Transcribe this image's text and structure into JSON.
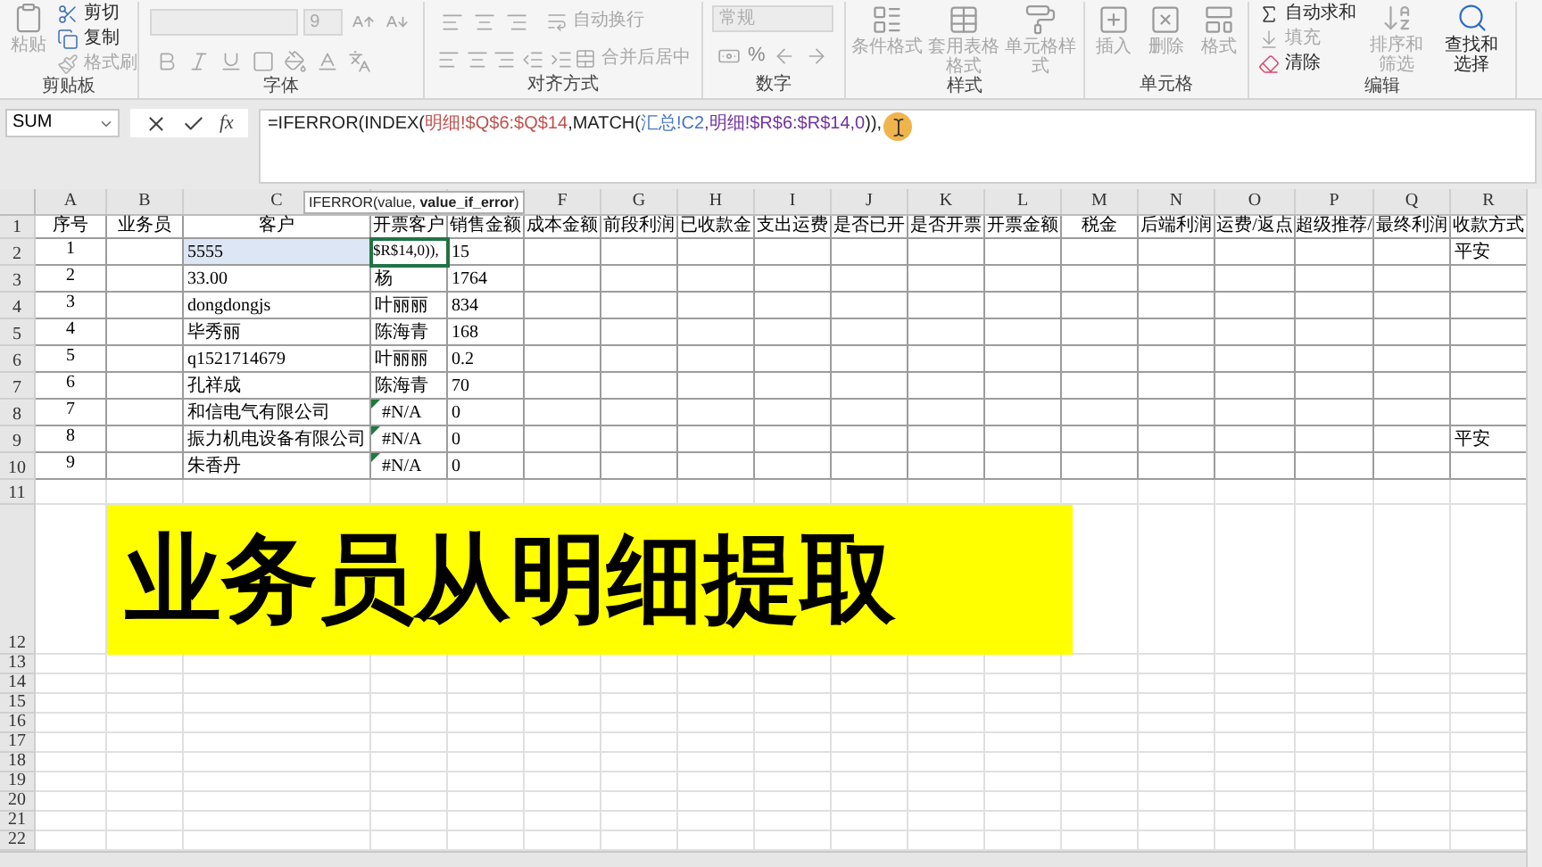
{
  "ribbon": {
    "groups": [
      {
        "kind": "clipboard",
        "label": "剪贴板",
        "buttons": [
          {
            "label": "粘贴",
            "disabled": true
          },
          {
            "label": "剪切",
            "disabled": false
          },
          {
            "label": "复制",
            "disabled": false
          },
          {
            "label": "格式刷",
            "disabled": true
          }
        ]
      },
      {
        "kind": "font",
        "label": "字体",
        "size": "9"
      },
      {
        "kind": "alignment",
        "label": "对齐方式",
        "buttons": [
          {
            "label": "自动换行",
            "disabled": true
          },
          {
            "label": "合并后居中",
            "disabled": true
          }
        ]
      },
      {
        "kind": "number",
        "label": "数字",
        "format": "常规",
        "percent": "%"
      },
      {
        "kind": "styles",
        "label": "样式",
        "buttons": [
          {
            "label": "条件格式",
            "disabled": true
          },
          {
            "label": "套用表格格式",
            "disabled": true
          },
          {
            "label": "单元格样式",
            "disabled": true
          }
        ]
      },
      {
        "kind": "cells",
        "label": "单元格",
        "buttons": [
          {
            "label": "插入",
            "disabled": true
          },
          {
            "label": "删除",
            "disabled": true
          },
          {
            "label": "格式",
            "disabled": true
          }
        ]
      },
      {
        "kind": "editing",
        "label": "编辑",
        "small": [
          {
            "label": "自动求和",
            "disabled": false
          },
          {
            "label": "填充",
            "disabled": true
          },
          {
            "label": "清除",
            "disabled": false
          }
        ],
        "large": [
          {
            "label": "排序和筛选",
            "disabled": true
          },
          {
            "label": "查找和选择",
            "disabled": false
          }
        ]
      }
    ]
  },
  "formula_bar": {
    "name_box": "SUM",
    "function_button": "fx",
    "segments": [
      {
        "text": "=IFERROR(INDEX(",
        "color": "#222222"
      },
      {
        "text": "明细!$Q$6:$Q$14",
        "color": "#c0504d"
      },
      {
        "text": ",MATCH(",
        "color": "#222222"
      },
      {
        "text": "汇总!C2",
        "color": "#4472c4"
      },
      {
        "text": ",明细!$R$6:$R$14,0",
        "color": "#7030a0"
      },
      {
        "text": ")),",
        "color": "#222222"
      }
    ]
  },
  "tooltip": "IFERROR(value, **value_if_error**)",
  "columns": [
    {
      "letter": "A"
    },
    {
      "letter": "B"
    },
    {
      "letter": "C"
    },
    {},
    {},
    {
      "letter": "F"
    },
    {
      "letter": "G"
    },
    {
      "letter": "H"
    },
    {
      "letter": "I"
    },
    {
      "letter": "J"
    },
    {
      "letter": "K"
    },
    {
      "letter": "L"
    },
    {
      "letter": "M"
    },
    {
      "letter": "N"
    },
    {
      "letter": "O"
    },
    {
      "letter": "P"
    },
    {
      "letter": "Q"
    },
    {
      "letter": "R"
    }
  ],
  "rows": [
    {
      "number": "1",
      "cells": [
        {
          "text": "序号"
        },
        {
          "text": "业务员"
        },
        {
          "text": "客户"
        },
        {
          "text": "开票客户"
        },
        {
          "text": "销售金额"
        },
        {
          "text": "成本金额"
        },
        {
          "text": "前段利润"
        },
        {
          "text": "已收款金"
        },
        {
          "text": "支出运费"
        },
        {
          "text": "是否已开"
        },
        {
          "text": "是否开票"
        },
        {
          "text": "开票金额"
        },
        {
          "text": "税金"
        },
        {
          "text": "后端利润"
        },
        {
          "text": "运费/返点"
        },
        {
          "text": "超级推荐/"
        },
        {
          "text": "最终利润"
        },
        {
          "text": "收款方式"
        }
      ]
    },
    {
      "number": "2",
      "cells": [
        {
          "text": "1"
        },
        null,
        {
          "text": "5555",
          "highlighted": true
        },
        {
          "text": "$R$14,0)),",
          "active": true
        },
        {
          "text": "15"
        },
        null,
        null,
        null,
        null,
        null,
        null,
        null,
        null,
        null,
        null,
        null,
        null,
        {
          "text": "平安"
        }
      ]
    },
    {
      "number": "3",
      "cells": [
        {
          "text": "2"
        },
        null,
        {
          "text": "33.00"
        },
        {
          "text": "杨"
        },
        {
          "text": "1764"
        }
      ]
    },
    {
      "number": "4",
      "cells": [
        {
          "text": "3"
        },
        null,
        {
          "text": "dongdongjs"
        },
        {
          "text": "叶丽丽"
        },
        {
          "text": "834"
        }
      ]
    },
    {
      "number": "5",
      "cells": [
        {
          "text": "4"
        },
        null,
        {
          "text": "毕秀丽"
        },
        {
          "text": "陈海青"
        },
        {
          "text": "168"
        }
      ]
    },
    {
      "number": "6",
      "cells": [
        {
          "text": "5"
        },
        null,
        {
          "text": "q1521714679"
        },
        {
          "text": "叶丽丽"
        },
        {
          "text": "0.2"
        }
      ]
    },
    {
      "number": "7",
      "cells": [
        {
          "text": "6"
        },
        null,
        {
          "text": "孔祥成"
        },
        {
          "text": "陈海青"
        },
        {
          "text": "70"
        }
      ]
    },
    {
      "number": "8",
      "cells": [
        {
          "text": "7"
        },
        null,
        {
          "text": "和信电气有限公司"
        },
        {
          "text": "#N/A",
          "error": true
        },
        {
          "text": "0"
        }
      ]
    },
    {
      "number": "9",
      "cells": [
        {
          "text": "8"
        },
        null,
        {
          "text": "振力机电设备有限公司"
        },
        {
          "text": "#N/A",
          "error": true
        },
        {
          "text": "0"
        },
        null,
        null,
        null,
        null,
        null,
        null,
        null,
        null,
        null,
        null,
        null,
        null,
        {
          "text": "平安"
        }
      ]
    },
    {
      "number": "10",
      "cells": [
        {
          "text": "9"
        },
        null,
        {
          "text": "朱香丹"
        },
        {
          "text": "#N/A",
          "error": true
        },
        {
          "text": "0"
        }
      ]
    },
    {
      "number": "11"
    },
    {
      "number": "12"
    },
    {
      "number": "13"
    },
    {
      "number": "14"
    },
    {
      "number": "15"
    },
    {
      "number": "16"
    },
    {
      "number": "17"
    },
    {
      "number": "18"
    },
    {
      "number": "19"
    },
    {
      "number": "20"
    },
    {
      "number": "21"
    },
    {
      "number": "22"
    }
  ],
  "caption": {
    "text": "业务员从明细提取"
  }
}
